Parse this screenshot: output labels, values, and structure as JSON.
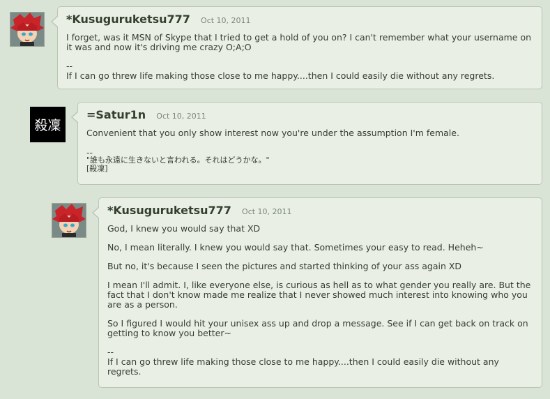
{
  "posts": [
    {
      "username": "*Kusuguruketsu777",
      "date": "Oct 10, 2011",
      "paragraphs": [
        "I forget, was it MSN of Skype that I tried to get a hold of you on? I can't remember what your username on it was and now it's driving me crazy O;A;O"
      ],
      "sig_sep": "--",
      "signature": "If I can go threw life making those close to me happy....then I could easily die without any regrets."
    },
    {
      "username": "=Satur1n",
      "date": "Oct 10, 2011",
      "avatar_text": "殺凜",
      "paragraphs": [
        "Convenient that you only show interest now you're under the assumption I'm female."
      ],
      "sig_sep": "--",
      "signature_lines": [
        "\"誰も永遠に生きないと言われる。それはどうかな。\"",
        "[殺凜]"
      ]
    },
    {
      "username": "*Kusuguruketsu777",
      "date": "Oct 10, 2011",
      "paragraphs": [
        "God, I knew you would say that XD",
        "No, I mean literally. I knew you would say that. Sometimes your easy to read. Heheh~",
        "But no, it's because I seen the pictures and started thinking of your ass again XD",
        "I mean I'll admit. I, like everyone else, is curious as hell as to what gender you really are. But the fact that I don't know made me realize that I never showed much interest into knowing who you are as a person.",
        "So I figured I would hit your unisex ass up and drop a message. See if I can get back on track on getting to know you better~"
      ],
      "sig_sep": "--",
      "signature": "If I can go threw life making those close to me happy....then I could easily die without any regrets."
    }
  ]
}
